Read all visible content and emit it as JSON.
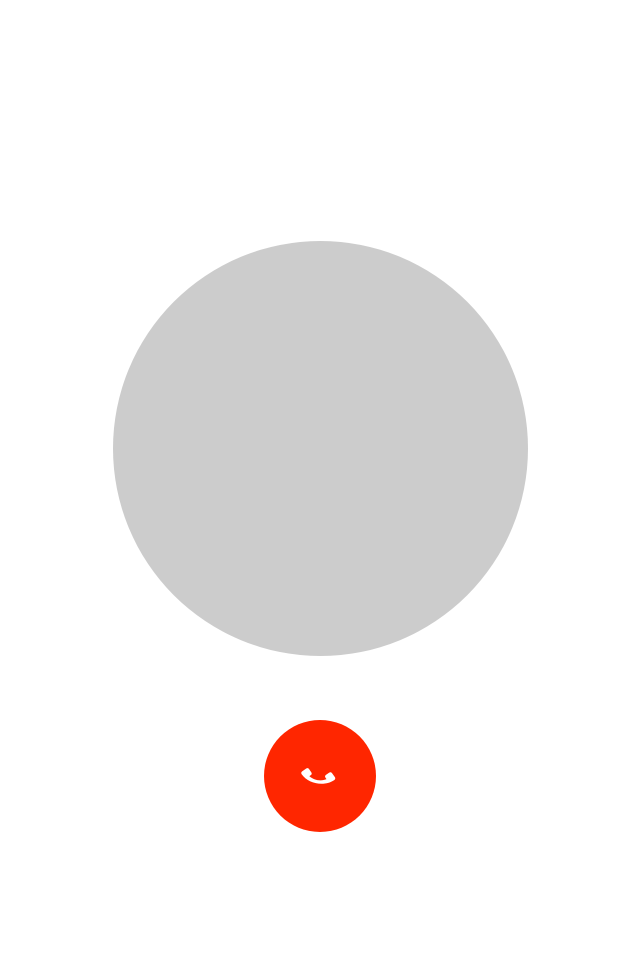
{
  "colors": {
    "background": "#ffffff",
    "avatar_placeholder": "#cccccc",
    "end_call_button": "#ff2600",
    "icon": "#ffffff"
  },
  "avatar": {
    "icon": "avatar-placeholder"
  },
  "call_controls": {
    "end_call": {
      "icon": "phone-icon"
    }
  }
}
